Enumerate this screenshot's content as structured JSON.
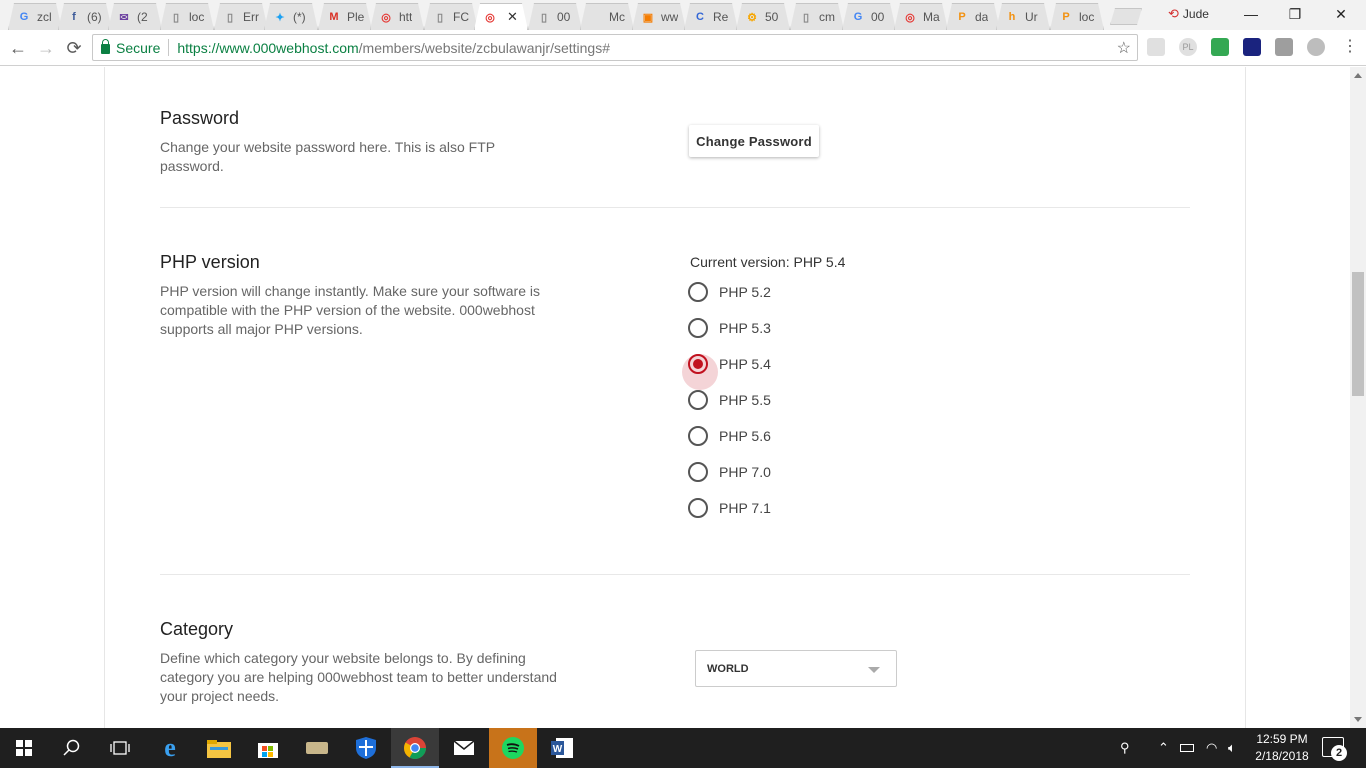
{
  "browser": {
    "tabs": [
      {
        "label": "zcl",
        "icon": "google-icon",
        "color": "#4285f4",
        "glyph": "G"
      },
      {
        "label": "(6)",
        "icon": "facebook-icon",
        "color": "#3b5998",
        "glyph": "f"
      },
      {
        "label": "(2",
        "icon": "mail-icon",
        "color": "#6b3fa0",
        "glyph": "✉"
      },
      {
        "label": "loc",
        "icon": "page-icon",
        "color": "#888888",
        "glyph": "▯"
      },
      {
        "label": "Err",
        "icon": "page-icon",
        "color": "#888888",
        "glyph": "▯"
      },
      {
        "label": "(*)",
        "icon": "twitter-icon",
        "color": "#1da1f2",
        "glyph": "✦"
      },
      {
        "label": "Ple",
        "icon": "gmail-icon",
        "color": "#d93025",
        "glyph": "M"
      },
      {
        "label": "htt",
        "icon": "webhost-icon",
        "color": "#e53935",
        "glyph": "◎"
      },
      {
        "label": "FC",
        "icon": "page-icon",
        "color": "#888888",
        "glyph": "▯"
      },
      {
        "label": "",
        "icon": "webhost-icon",
        "color": "#e53935",
        "glyph": "◎",
        "active": true
      },
      {
        "label": "00",
        "icon": "page-icon",
        "color": "#888888",
        "glyph": "▯"
      },
      {
        "label": "Mc",
        "icon": "blank-icon",
        "color": "#ffffff",
        "glyph": ""
      },
      {
        "label": "ww",
        "icon": "orange-app-icon",
        "color": "#f57c00",
        "glyph": "▣"
      },
      {
        "label": "Re",
        "icon": "circle-icon",
        "color": "#3367d6",
        "glyph": "C"
      },
      {
        "label": "50",
        "icon": "bitcoin-icon",
        "color": "#f7a600",
        "glyph": "⚙"
      },
      {
        "label": "cm",
        "icon": "page-icon",
        "color": "#888888",
        "glyph": "▯"
      },
      {
        "label": "00",
        "icon": "google-icon",
        "color": "#4285f4",
        "glyph": "G"
      },
      {
        "label": "Ma",
        "icon": "webhost-icon",
        "color": "#e53935",
        "glyph": "◎"
      },
      {
        "label": "da",
        "icon": "pma-icon",
        "color": "#f29111",
        "glyph": "P"
      },
      {
        "label": "Ur",
        "icon": "pma-icon",
        "color": "#f29111",
        "glyph": "h"
      },
      {
        "label": "loc",
        "icon": "pma-icon",
        "color": "#f29111",
        "glyph": "P"
      }
    ],
    "profile_name": "Jude",
    "close_glyph": "✕",
    "minimize_glyph": "—",
    "restore_glyph": "❐",
    "back_glyph": "←",
    "forward_glyph": "→",
    "reload_glyph": "⟳",
    "secure_label": "Secure",
    "url_host": "https://www.000webhost.com",
    "url_path": "/members/website/zcbulawanjr/settings#",
    "star_glyph": "☆",
    "menu_glyph": "⋮"
  },
  "password_section": {
    "title": "Password",
    "description": "Change your website password here. This is also FTP password.",
    "button_label": "Change Password"
  },
  "php_section": {
    "title": "PHP version",
    "description": "PHP version will change instantly. Make sure your software is compatible with the PHP version of the website. 000webhost supports all major PHP versions.",
    "current_version_label": "Current version: PHP 5.4",
    "selected": "PHP 5.4",
    "options": [
      "PHP 5.2",
      "PHP 5.3",
      "PHP 5.4",
      "PHP 5.5",
      "PHP 5.6",
      "PHP 7.0",
      "PHP 7.1"
    ]
  },
  "category_section": {
    "title": "Category",
    "description": "Define which category your website belongs to. By defining category you are helping 000webhost team to better understand your project needs.",
    "selected_value": "WORLD"
  },
  "colors": {
    "accent": "#c1121f",
    "secure_green": "#0b8043"
  },
  "taskbar": {
    "clock_time": "12:59 PM",
    "clock_date": "2/18/2018",
    "notification_count": "2"
  }
}
